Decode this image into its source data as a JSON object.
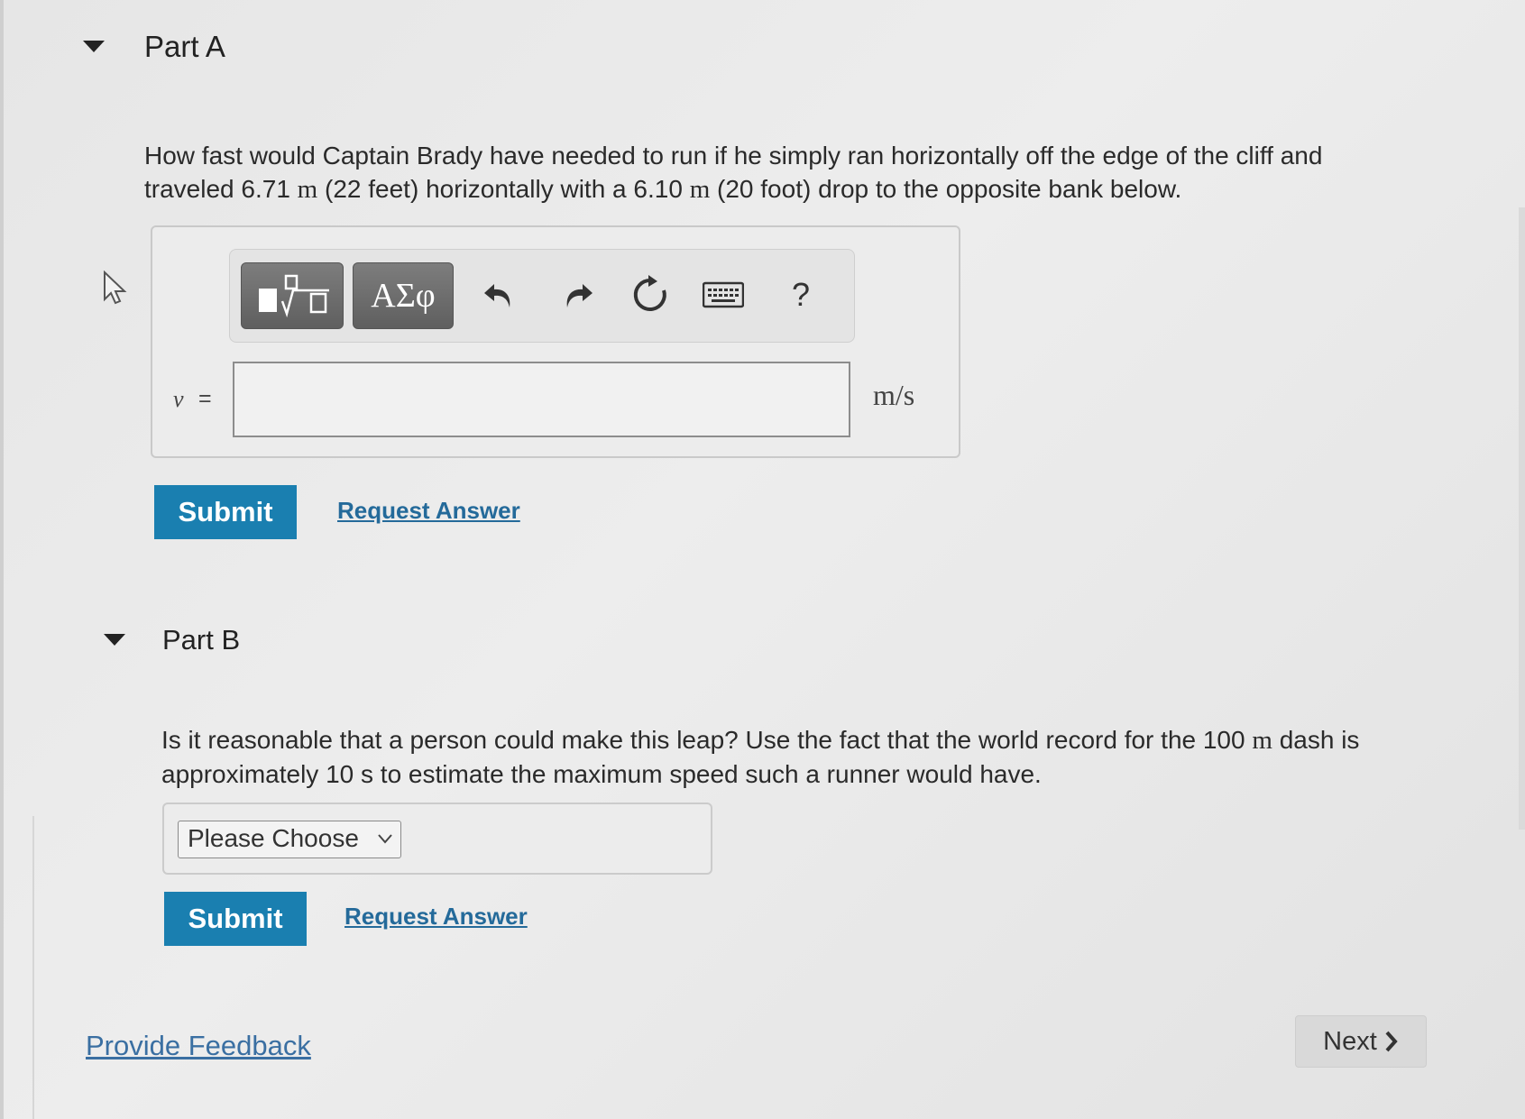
{
  "part_a": {
    "title": "Part A",
    "question_1": "How fast would Captain Brady have needed to run if he simply ran horizontally off the edge of the cliff and",
    "question_2a": "traveled 6.71 ",
    "question_2_unit1": "m",
    "question_2b": " (22 feet) horizontally with a 6.10 ",
    "question_2_unit2": "m",
    "question_2c": " (20 foot) drop to the opposite bank below.",
    "toolbar": {
      "greek_label": "ΑΣφ",
      "help_label": "?"
    },
    "variable": "v",
    "equals": "=",
    "answer_value": "",
    "unit": "m/s",
    "submit_label": "Submit",
    "request_label": "Request Answer"
  },
  "part_b": {
    "title": "Part B",
    "question_1a": "Is it reasonable that a person could make this leap? Use the fact that the world record for the 100 ",
    "question_1_unit": "m",
    "question_1b": " dash is",
    "question_2": "approximately 10 s to estimate the maximum speed such a runner would have.",
    "select_value": "Please Choose",
    "submit_label": "Submit",
    "request_label": "Request Answer"
  },
  "footer": {
    "feedback_label": "Provide Feedback",
    "next_label": "Next"
  },
  "colors": {
    "submit_bg": "#1a7fb0",
    "link": "#246a9a",
    "toolbar_button": "#6e6e6e"
  },
  "icons": [
    "caret-down-icon",
    "templates-icon",
    "undo-icon",
    "redo-icon",
    "reset-icon",
    "keyboard-icon",
    "chevron-down-icon",
    "chevron-right-icon",
    "mouse-pointer-icon"
  ]
}
